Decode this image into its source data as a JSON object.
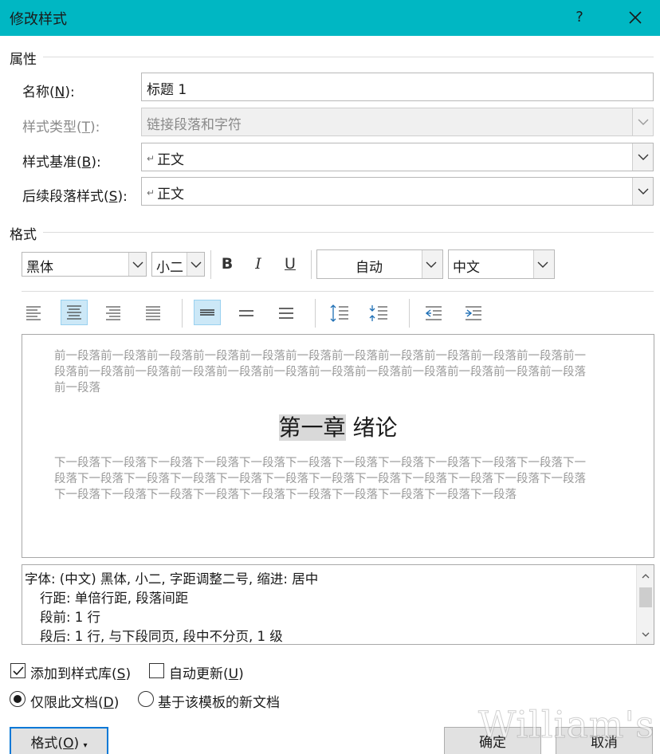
{
  "window": {
    "title": "修改样式",
    "help_label": "?"
  },
  "properties": {
    "section_label": "属性",
    "name_label": "名称(N):",
    "name_value": "标题 1",
    "style_type_label": "样式类型(T):",
    "style_type_value": "链接段落和字符",
    "style_based_on_label": "样式基准(B):",
    "style_based_on_value": "正文",
    "next_style_label": "后续段落样式(S):",
    "next_style_value": "正文",
    "paragraph_mark": "↵"
  },
  "format": {
    "section_label": "格式",
    "font_value": "黑体",
    "size_value": "小二",
    "bold_label": "B",
    "italic_label": "I",
    "underline_label": "U",
    "color_value": "自动",
    "script_value": "中文"
  },
  "preview": {
    "previous_paragraph_text": "前一段落前一段落前一段落前一段落前一段落前一段落前一段落前一段落前一段落前一段落前一段落前一段落前一段落前一段落前一段落前一段落前一段落前一段落前一段落前一段落前一段落前一段落前一段落前一段落",
    "heading_part1": "第一章",
    "heading_part2": "绪论",
    "next_paragraph_text": "下一段落下一段落下一段落下一段落下一段落下一段落下一段落下一段落下一段落下一段落下一段落下一段落下一段落下一段落下一段落下一段落下一段落下一段落下一段落下一段落下一段落下一段落下一段落下一段落下一段落下一段落下一段落下一段落下一段落下一段落下一段落下一段落下一段落"
  },
  "description": {
    "line1": "字体: (中文) 黑体, 小二, 字距调整二号, 缩进: 居中",
    "line2": "行距: 单倍行距, 段落间距",
    "line3": "段前: 1 行",
    "line4": "段后: 1 行, 与下段同页, 段中不分页, 1 级"
  },
  "options": {
    "add_to_gallery_label": "添加到样式库(S)",
    "add_to_gallery_checked": true,
    "auto_update_label": "自动更新(U)",
    "auto_update_checked": false,
    "only_this_document_label": "仅限此文档(D)",
    "only_this_document_selected": true,
    "new_docs_template_label": "基于该模板的新文档",
    "new_docs_template_selected": false
  },
  "buttons": {
    "format_label": "格式(O)",
    "ok_label": "确定",
    "cancel_label": "取消"
  },
  "watermark": "William's",
  "colors": {
    "titlebar": "#00b7c3",
    "active_toggle": "#cce8f7",
    "focus_border": "#0078d7"
  }
}
